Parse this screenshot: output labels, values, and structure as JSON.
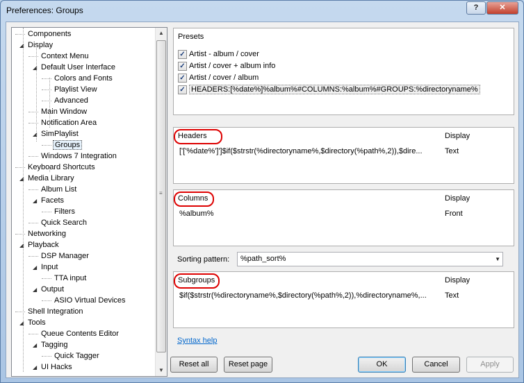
{
  "window": {
    "title": "Preferences: Groups",
    "help_glyph": "?",
    "close_glyph": "✕"
  },
  "tree": {
    "items": [
      {
        "label": "Components",
        "level": 0,
        "expander": ""
      },
      {
        "label": "Display",
        "level": 0,
        "expander": "◢"
      },
      {
        "label": "Context Menu",
        "level": 1,
        "expander": ""
      },
      {
        "label": "Default User Interface",
        "level": 1,
        "expander": "◢"
      },
      {
        "label": "Colors and Fonts",
        "level": 2,
        "expander": ""
      },
      {
        "label": "Playlist View",
        "level": 2,
        "expander": ""
      },
      {
        "label": "Advanced",
        "level": 2,
        "expander": ""
      },
      {
        "label": "Main Window",
        "level": 1,
        "expander": ""
      },
      {
        "label": "Notification Area",
        "level": 1,
        "expander": ""
      },
      {
        "label": "SimPlaylist",
        "level": 1,
        "expander": "◢"
      },
      {
        "label": "Groups",
        "level": 2,
        "expander": "",
        "selected": true
      },
      {
        "label": "Windows 7 Integration",
        "level": 1,
        "expander": ""
      },
      {
        "label": "Keyboard Shortcuts",
        "level": 0,
        "expander": ""
      },
      {
        "label": "Media Library",
        "level": 0,
        "expander": "◢"
      },
      {
        "label": "Album List",
        "level": 1,
        "expander": ""
      },
      {
        "label": "Facets",
        "level": 1,
        "expander": "◢"
      },
      {
        "label": "Filters",
        "level": 2,
        "expander": ""
      },
      {
        "label": "Quick Search",
        "level": 1,
        "expander": ""
      },
      {
        "label": "Networking",
        "level": 0,
        "expander": ""
      },
      {
        "label": "Playback",
        "level": 0,
        "expander": "◢"
      },
      {
        "label": "DSP Manager",
        "level": 1,
        "expander": ""
      },
      {
        "label": "Input",
        "level": 1,
        "expander": "◢"
      },
      {
        "label": "TTA input",
        "level": 2,
        "expander": ""
      },
      {
        "label": "Output",
        "level": 1,
        "expander": "◢"
      },
      {
        "label": "ASIO Virtual Devices",
        "level": 2,
        "expander": ""
      },
      {
        "label": "Shell Integration",
        "level": 0,
        "expander": ""
      },
      {
        "label": "Tools",
        "level": 0,
        "expander": "◢"
      },
      {
        "label": "Queue Contents Editor",
        "level": 1,
        "expander": ""
      },
      {
        "label": "Tagging",
        "level": 1,
        "expander": "◢"
      },
      {
        "label": "Quick Tagger",
        "level": 2,
        "expander": ""
      },
      {
        "label": "UI Hacks",
        "level": 1,
        "expander": "◢"
      }
    ],
    "scroll_up": "▲",
    "scroll_down": "▼",
    "grip": "≡"
  },
  "presets": {
    "title": "Presets",
    "items": [
      {
        "label": "Artist - album / cover",
        "checked": true
      },
      {
        "label": "Artist / cover + album info",
        "checked": true
      },
      {
        "label": "Artist / cover / album",
        "checked": true
      },
      {
        "label": "HEADERS:[%date%]%album%#COLUMNS:%album%#GROUPS:%directoryname%",
        "checked": true
      }
    ],
    "check_glyph": "✓"
  },
  "headers": {
    "title": "Headers",
    "display_col": "Display",
    "rows": [
      {
        "text": "['['%date%']']$if($strstr(%directoryname%,$directory(%path%,2)),$dire...",
        "display": "Text"
      }
    ]
  },
  "columns": {
    "title": "Columns",
    "display_col": "Display",
    "rows": [
      {
        "text": "%album%",
        "display": "Front"
      }
    ]
  },
  "sorting": {
    "label": "Sorting pattern:",
    "value": "%path_sort%",
    "arrow": "▼"
  },
  "subgroups": {
    "title": "Subgroups",
    "display_col": "Display",
    "rows": [
      {
        "text": "$if($strstr(%directoryname%,$directory(%path%,2)),%directoryname%,...",
        "display": "Text"
      }
    ]
  },
  "links": {
    "syntax_help": "Syntax help"
  },
  "buttons": {
    "reset_all": "Reset all",
    "reset_page": "Reset page",
    "ok": "OK",
    "cancel": "Cancel",
    "apply": "Apply"
  },
  "colors": {
    "highlight": "#dd0000",
    "link": "#0066cc"
  }
}
